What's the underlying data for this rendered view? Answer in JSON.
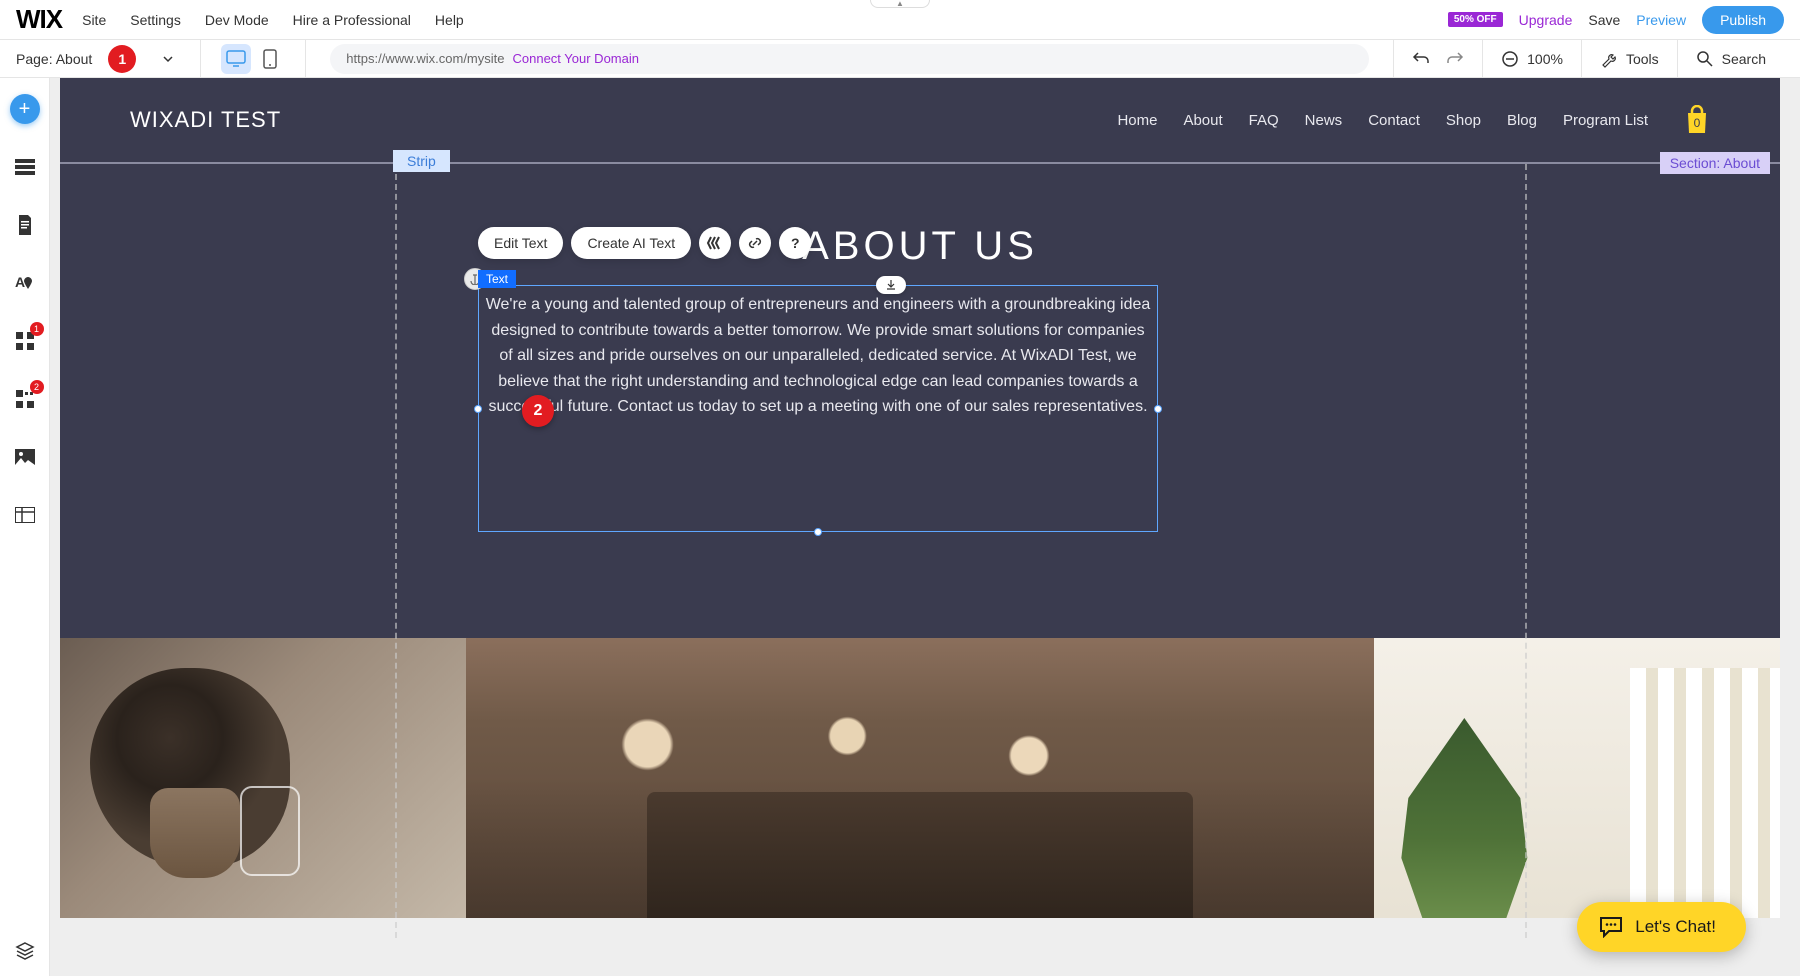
{
  "logo": "WIX",
  "menu": [
    "Site",
    "Settings",
    "Dev Mode",
    "Hire a Professional",
    "Help"
  ],
  "promo": "50% OFF",
  "upgrade": "Upgrade",
  "save": "Save",
  "preview": "Preview",
  "publish": "Publish",
  "page_label": "Page: About",
  "badges": {
    "b1": "1",
    "b2": "2",
    "sb1": "1",
    "sb2": "2"
  },
  "url": "https://www.wix.com/mysite",
  "connect_domain": "Connect Your Domain",
  "zoom": "100%",
  "tools": "Tools",
  "search": "Search",
  "site": {
    "title": "WIXADI TEST",
    "nav": [
      "Home",
      "About",
      "FAQ",
      "News",
      "Contact",
      "Shop",
      "Blog",
      "Program List"
    ],
    "cart_count": "0"
  },
  "strip_label": "Strip",
  "section_label": "Section: About",
  "heading": "ABOUT US",
  "float": {
    "edit": "Edit Text",
    "ai": "Create AI Text"
  },
  "text_tag": "Text",
  "body_text": "We're a young and talented group of entrepreneurs and engineers with a groundbreaking idea designed to contribute towards a better tomorrow. We provide smart solutions for companies of all sizes and pride ourselves on our unparalleled, dedicated service. At WixADI Test, we believe that the right understanding and technological edge can lead companies towards a successful future. Contact us today to set up a meeting with one of our sales representatives.",
  "chat": "Let's Chat!"
}
